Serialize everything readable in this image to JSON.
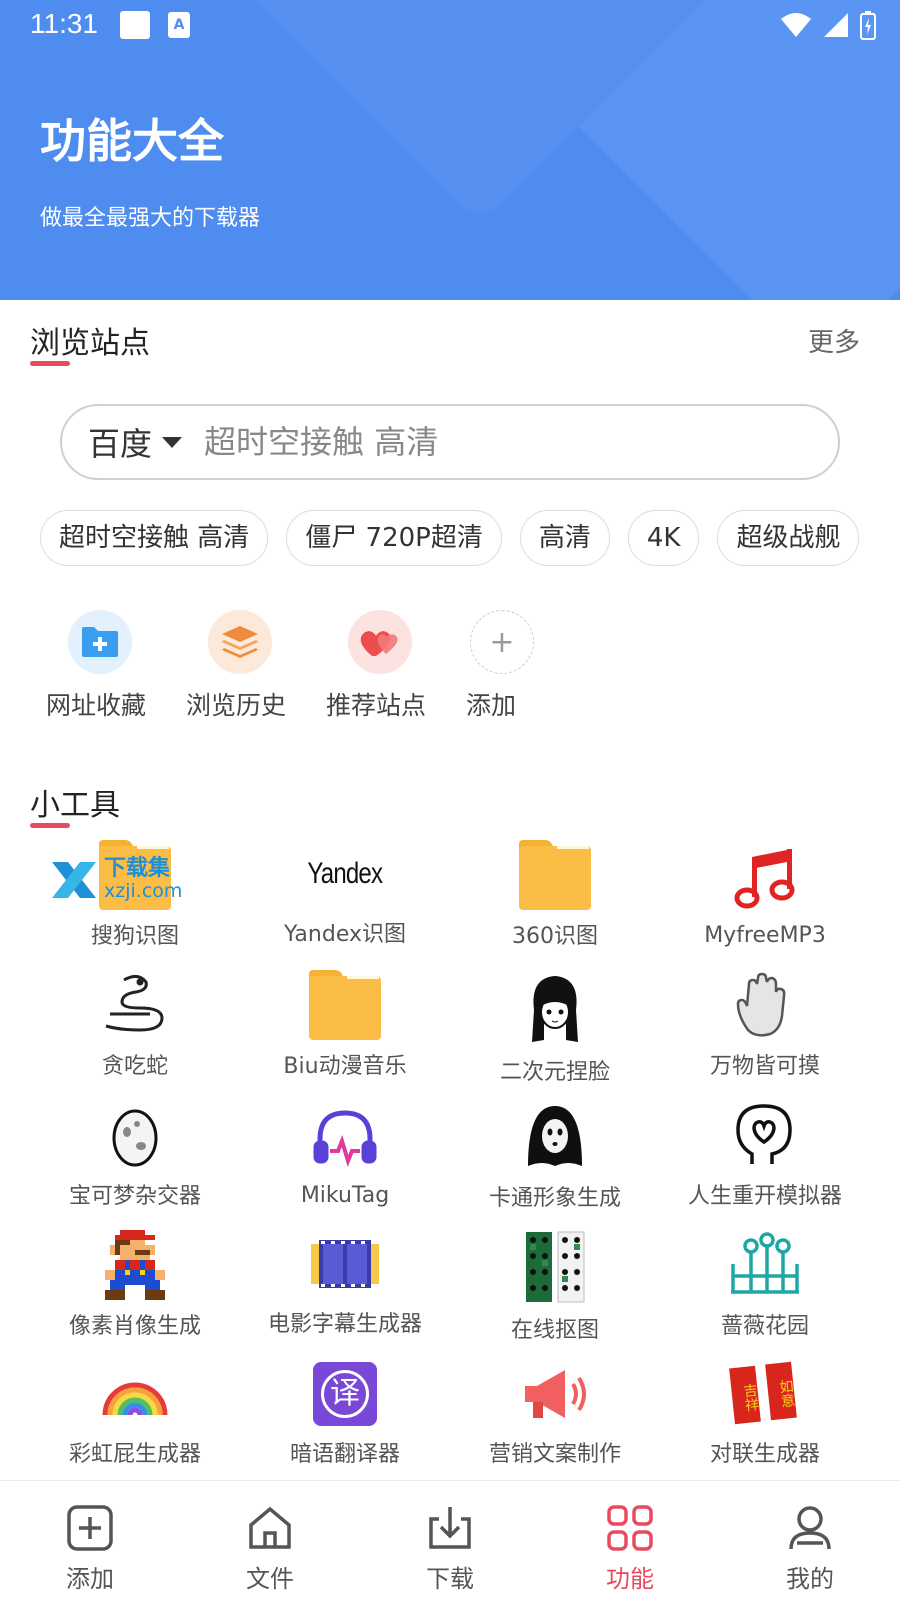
{
  "status": {
    "time": "11:31"
  },
  "header": {
    "title": "功能大全",
    "subtitle": "做最全最强大的下载器"
  },
  "browse": {
    "title": "浏览站点",
    "more": "更多",
    "search": {
      "engine": "百度",
      "placeholder": "超时空接触 高清"
    },
    "chips": [
      "超时空接触 高清",
      "僵尸 720P超清",
      "高清",
      "4K",
      "超级战舰"
    ],
    "shortcuts": [
      {
        "label": "网址收藏",
        "icon": "folder-plus-icon"
      },
      {
        "label": "浏览历史",
        "icon": "layers-icon"
      },
      {
        "label": "推荐站点",
        "icon": "hearts-icon"
      },
      {
        "label": "添加",
        "icon": "plus-icon"
      }
    ]
  },
  "tools": {
    "title": "小工具",
    "watermark": {
      "text": "下载集",
      "sub": "xzji.com"
    },
    "items": [
      {
        "label": "搜狗识图",
        "icon": "folder-icon"
      },
      {
        "label": "Yandex识图",
        "icon": "yandex-logo",
        "logo_text": "Yandex"
      },
      {
        "label": "360识图",
        "icon": "folder-icon"
      },
      {
        "label": "MyfreeMP3",
        "icon": "music-note-icon"
      },
      {
        "label": "贪吃蛇",
        "icon": "snake-icon"
      },
      {
        "label": "Biu动漫音乐",
        "icon": "folder-icon"
      },
      {
        "label": "二次元捏脸",
        "icon": "anime-girl-icon"
      },
      {
        "label": "万物皆可摸",
        "icon": "hand-icon"
      },
      {
        "label": "宝可梦杂交器",
        "icon": "egg-icon"
      },
      {
        "label": "MikuTag",
        "icon": "headphones-icon"
      },
      {
        "label": "卡通形象生成",
        "icon": "ghost-icon"
      },
      {
        "label": "人生重开模拟器",
        "icon": "head-heart-icon"
      },
      {
        "label": "像素肖像生成",
        "icon": "pixel-mario-icon"
      },
      {
        "label": "电影字幕生成器",
        "icon": "film-strip-icon"
      },
      {
        "label": "在线抠图",
        "icon": "sticker-sheet-icon"
      },
      {
        "label": "蔷薇花园",
        "icon": "garden-icon"
      },
      {
        "label": "彩虹屁生成器",
        "icon": "rainbow-icon"
      },
      {
        "label": "暗语翻译器",
        "icon": "translate-icon",
        "glyph": "译"
      },
      {
        "label": "营销文案制作",
        "icon": "megaphone-icon"
      },
      {
        "label": "对联生成器",
        "icon": "couplet-icon",
        "glyph_left": "吉祥",
        "glyph_right": "如意"
      }
    ]
  },
  "nav": [
    {
      "label": "添加",
      "icon": "add-square-icon",
      "active": false
    },
    {
      "label": "文件",
      "icon": "home-icon",
      "active": false
    },
    {
      "label": "下载",
      "icon": "download-icon",
      "active": false
    },
    {
      "label": "功能",
      "icon": "grid-icon",
      "active": true
    },
    {
      "label": "我的",
      "icon": "user-icon",
      "active": false
    }
  ],
  "colors": {
    "primary": "#4f8cf0",
    "accent": "#e84a5f",
    "folder": "#fbbd46"
  }
}
